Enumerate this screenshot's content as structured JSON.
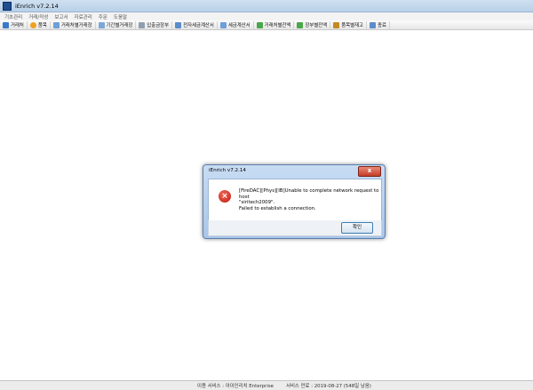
{
  "window": {
    "title": "iEnrich v7.2.14"
  },
  "menu": [
    "기초관리",
    "거래/작성",
    "보고서",
    "자료관리",
    "주문",
    "도움말"
  ],
  "toolbar": [
    {
      "label": "거래처",
      "icon": "person-icon"
    },
    {
      "label": "품목",
      "icon": "coin-icon"
    },
    {
      "label": "거래처별거래장",
      "icon": "document-icon"
    },
    {
      "label": "기간별거래장",
      "icon": "calendar-icon"
    },
    {
      "label": "입출금장부",
      "icon": "ledger-icon"
    },
    {
      "label": "전자세금계산서",
      "icon": "tax-invoice-icon"
    },
    {
      "label": "세금계산서",
      "icon": "invoice-icon"
    },
    {
      "label": "거래처별잔액",
      "icon": "balance-icon"
    },
    {
      "label": "장부별잔액",
      "icon": "book-balance-icon"
    },
    {
      "label": "품목별재고",
      "icon": "stock-icon"
    },
    {
      "label": "종료",
      "icon": "exit-icon"
    }
  ],
  "dialog": {
    "title": "iEnrich v7.2.14",
    "close_label": "x",
    "message_line1": "[FireDAC][Phys][IB]Unable to complete network request to host",
    "message_line2": "\"siritech2009\".",
    "message_line3": "Failed to establish a connection.",
    "ok_label": "확인"
  },
  "status": {
    "service": "이용 서비스 : 아이인리치 Enterprise",
    "expiry": "서비스 만료 : 2019-08-27 (548일 남음)"
  }
}
